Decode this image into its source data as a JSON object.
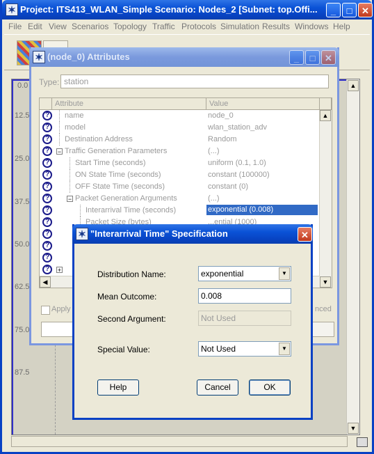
{
  "main_window": {
    "title": "Project: ITS413_WLAN_Simple Scenario: Nodes_2  [Subnet: top.Offi...",
    "menu": [
      "File",
      "Edit",
      "View",
      "Scenarios",
      "Topology",
      "Traffic",
      "Protocols",
      "Simulation",
      "Results",
      "Windows",
      "Help"
    ],
    "y_ticks": [
      "0.0",
      "12.5",
      "25.0",
      "37.5",
      "50.0",
      "62.5",
      "75.0",
      "87.5"
    ]
  },
  "attributes_window": {
    "title": "(node_0) Attributes",
    "type_label": "Type:",
    "type_value": "station",
    "col_attribute": "Attribute",
    "col_value": "Value",
    "rows": [
      {
        "name": "name",
        "value": "node_0"
      },
      {
        "name": "model",
        "value": "wlan_station_adv"
      },
      {
        "name": "Destination Address",
        "value": "Random"
      },
      {
        "name": "Traffic Generation Parameters",
        "value": "(...)"
      },
      {
        "name": "Start Time (seconds)",
        "value": "uniform (0.1, 1.0)"
      },
      {
        "name": "ON State Time (seconds)",
        "value": "constant (100000)"
      },
      {
        "name": "OFF State Time (seconds)",
        "value": "constant (0)"
      },
      {
        "name": "Packet Generation Arguments",
        "value": "(...)"
      },
      {
        "name": "Interarrival Time (seconds)",
        "value": "exponential (0.008)"
      },
      {
        "name": "Packet Size (bytes)",
        "value": "...ential (1000)"
      }
    ],
    "apply_label": "Apply t",
    "advanced_label": "nced"
  },
  "dialog": {
    "title": "\"Interarrival Time\" Specification",
    "distribution_label": "Distribution Name:",
    "distribution_value": "exponential",
    "mean_label": "Mean Outcome:",
    "mean_value": "0.008",
    "second_label": "Second Argument:",
    "second_value": "Not Used",
    "special_label": "Special Value:",
    "special_value": "Not Used",
    "help_button": "Help",
    "cancel_button": "Cancel",
    "ok_button": "OK"
  }
}
